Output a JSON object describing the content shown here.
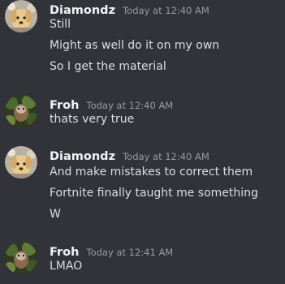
{
  "messages": [
    {
      "author": "Diamondz",
      "timestamp": "Today at 12:40 AM",
      "lines": [
        "Still",
        "Might as well do it on my own",
        "So I get the material"
      ]
    },
    {
      "author": "Froh",
      "timestamp": "Today at 12:40 AM",
      "lines": [
        "thats very true"
      ]
    },
    {
      "author": "Diamondz",
      "timestamp": "Today at 12:40 AM",
      "lines": [
        "And make mistakes to correct them",
        "Fortnite finally taught me something",
        "W"
      ]
    },
    {
      "author": "Froh",
      "timestamp": "Today at 12:41 AM",
      "lines": [
        "LMAO"
      ]
    }
  ],
  "colors": {
    "background": "#313338",
    "author_name": "#f2f3f5",
    "message_text": "#dbdee1",
    "timestamp": "#949ba4"
  }
}
